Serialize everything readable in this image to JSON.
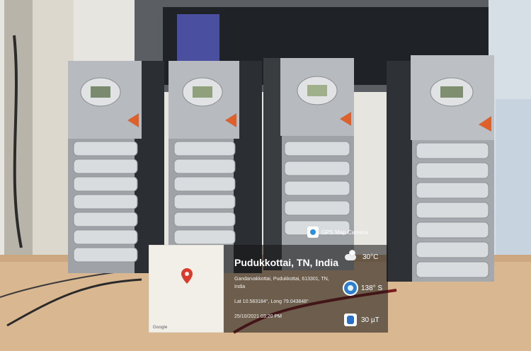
{
  "overlay": {
    "app_name": "GPS Map Camera",
    "city": "Pudukkottai, TN, India",
    "address": "Gandarvakkottai, Pudukkottai, 613301, TN, India",
    "latlong": "Lat 10.583184°, Long 79.043848°",
    "datetime": "25/10/2021 03:20 PM",
    "temperature": "30°C",
    "wind": "138° S",
    "magnetic": "30 µT"
  },
  "map": {
    "attribution": "Google"
  },
  "icons": {
    "location_pin": "location-pin-icon",
    "camera": "camera-icon",
    "temperature": "weather-cloud-icon",
    "wind": "compass-icon",
    "magnetic": "magnet-icon"
  },
  "colors": {
    "pin": "#d93a2b",
    "panel_bg": "rgba(20,20,20,0.55)",
    "accent": "#2f7fd0"
  }
}
